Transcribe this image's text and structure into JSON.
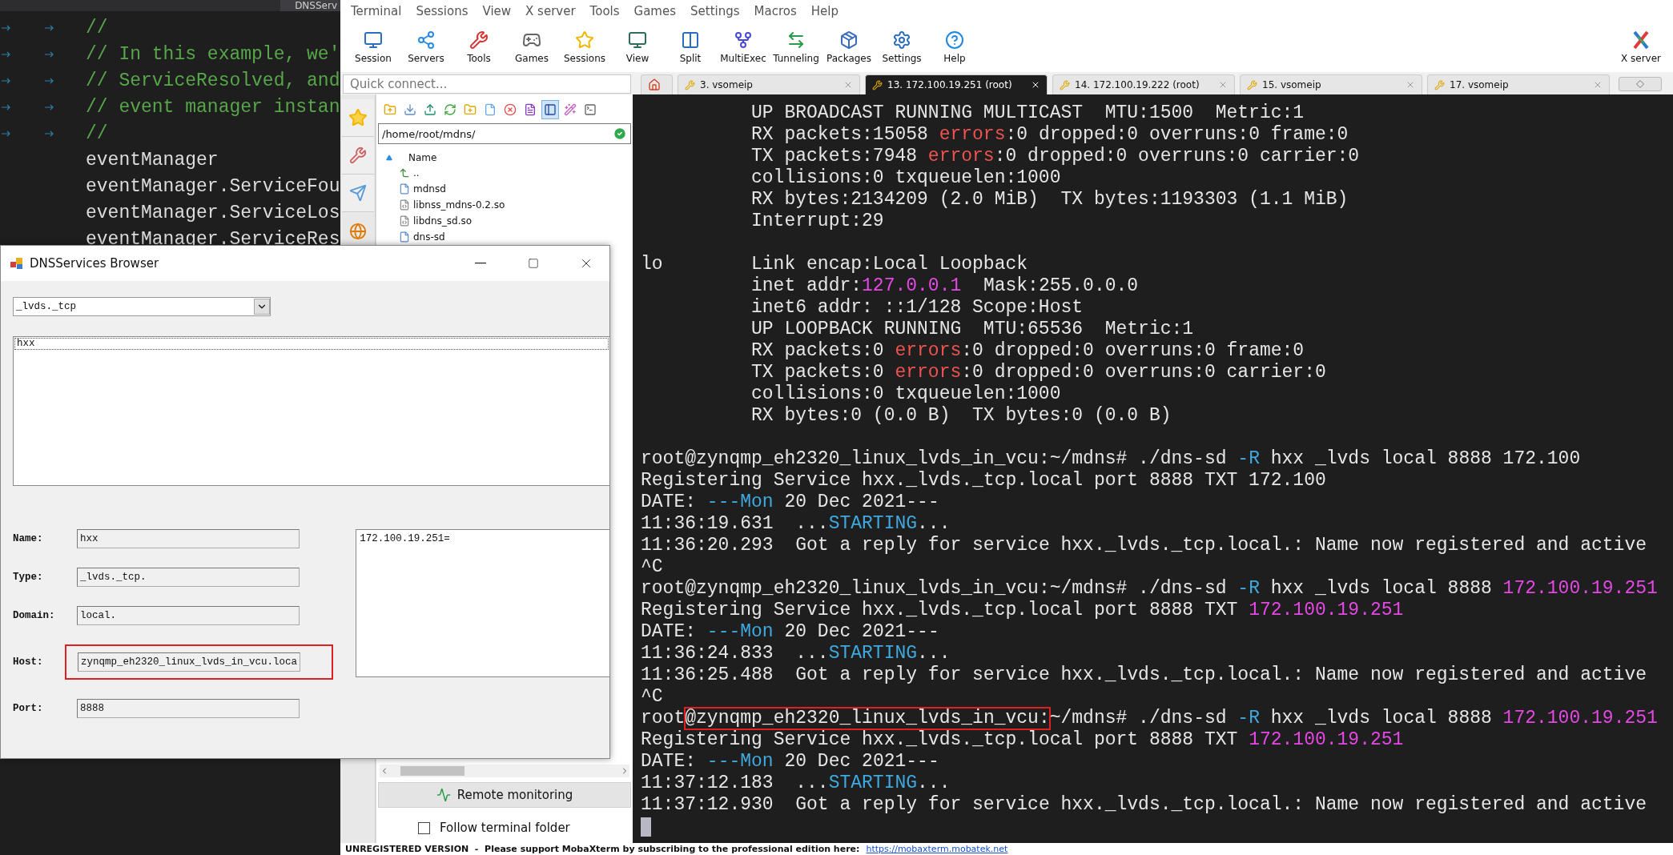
{
  "editor": {
    "tab": "DNSServ",
    "lines": [
      {
        "kind": "comment",
        "text": "//"
      },
      {
        "kind": "comment",
        "text": "// In this example, we'"
      },
      {
        "kind": "comment",
        "text": "// ServiceResolved, and"
      },
      {
        "kind": "comment",
        "text": "// event manager instan"
      },
      {
        "kind": "comment",
        "text": "//"
      },
      {
        "kind": "code",
        "text": "eventManager"
      },
      {
        "kind": "code",
        "text": "eventManager.ServiceFou"
      },
      {
        "kind": "code",
        "text": "eventManager.ServiceLos"
      },
      {
        "kind": "code",
        "text": "eventManager.ServiceRes"
      }
    ]
  },
  "menu": [
    "Terminal",
    "Sessions",
    "View",
    "X server",
    "Tools",
    "Games",
    "Settings",
    "Macros",
    "Help"
  ],
  "toolbar": [
    {
      "label": "Session"
    },
    {
      "label": "Servers"
    },
    {
      "label": "Tools"
    },
    {
      "label": "Games"
    },
    {
      "label": "Sessions"
    },
    {
      "label": "View"
    },
    {
      "label": "Split"
    },
    {
      "label": "MultiExec"
    },
    {
      "label": "Tunneling"
    },
    {
      "label": "Packages"
    },
    {
      "label": "Settings"
    },
    {
      "label": "Help"
    }
  ],
  "toolbar_right": {
    "label": "X server"
  },
  "quick_connect": {
    "placeholder": "Quick connect..."
  },
  "tabs": [
    {
      "kind": "home",
      "selected": false
    },
    {
      "kind": "session",
      "label": "3. vsomeip",
      "selected": false
    },
    {
      "kind": "session",
      "label": "13. 172.100.19.251 (root)",
      "selected": true
    },
    {
      "kind": "session",
      "label": "14. 172.100.19.222 (root)",
      "selected": false
    },
    {
      "kind": "session",
      "label": "15. vsomeip",
      "selected": false
    },
    {
      "kind": "session",
      "label": "17. vsomeip",
      "selected": false
    }
  ],
  "file_browser": {
    "path": "/home/root/mdns/",
    "column": "Name",
    "files": [
      {
        "name": "..",
        "kind": "parent"
      },
      {
        "name": "mdnsd",
        "kind": "file"
      },
      {
        "name": "libnss_mdns-0.2.so",
        "kind": "library"
      },
      {
        "name": "libdns_sd.so",
        "kind": "library"
      },
      {
        "name": "dns-sd",
        "kind": "file"
      }
    ]
  },
  "remote_monitoring": "Remote monitoring",
  "follow_terminal": {
    "label": "Follow terminal folder",
    "checked": false
  },
  "status_bar": {
    "text": "UNREGISTERED VERSION  -  Please support MobaXterm by subscribing to the professional edition here:",
    "link": "https://mobaxterm.mobatek.net"
  },
  "terminal": {
    "lines": [
      {
        "indent": true,
        "segments": [
          {
            "text": "UP BROADCAST RUNNING MULTICAST  MTU:1500  Metric:1",
            "color": "#e6e6e6"
          }
        ]
      },
      {
        "indent": true,
        "segments": [
          {
            "text": "RX packets:15058 ",
            "color": "#e6e6e6"
          },
          {
            "text": "errors",
            "color": "#ef5350"
          },
          {
            "text": ":0 dropped:0 overruns:0 frame:0",
            "color": "#e6e6e6"
          }
        ]
      },
      {
        "indent": true,
        "segments": [
          {
            "text": "TX packets:7948 ",
            "color": "#e6e6e6"
          },
          {
            "text": "errors",
            "color": "#ef5350"
          },
          {
            "text": ":0 dropped:0 overruns:0 carrier:0",
            "color": "#e6e6e6"
          }
        ]
      },
      {
        "indent": true,
        "segments": [
          {
            "text": "collisions:0 txqueuelen:1000",
            "color": "#e6e6e6"
          }
        ]
      },
      {
        "indent": true,
        "segments": [
          {
            "text": "RX bytes:2134209 (2.0 MiB)  TX bytes:1193303 (1.1 MiB)",
            "color": "#e6e6e6"
          }
        ]
      },
      {
        "indent": true,
        "segments": [
          {
            "text": "Interrupt:29",
            "color": "#e6e6e6"
          }
        ]
      },
      {
        "indent": true,
        "gap_before": true,
        "label": "lo",
        "segments": [
          {
            "text": "Link encap:Local Loopback",
            "color": "#e6e6e6"
          }
        ]
      },
      {
        "indent": true,
        "segments": [
          {
            "text": "inet addr:",
            "color": "#e6e6e6"
          },
          {
            "text": "127.0.0.1",
            "color": "#e548e5"
          },
          {
            "text": "  Mask:255.0.0.0",
            "color": "#e6e6e6"
          }
        ]
      },
      {
        "indent": true,
        "segments": [
          {
            "text": "inet6 addr: ::1/128 Scope:Host",
            "color": "#e6e6e6"
          }
        ]
      },
      {
        "indent": true,
        "segments": [
          {
            "text": "UP LOOPBACK RUNNING  MTU:65536  Metric:1",
            "color": "#e6e6e6"
          }
        ]
      },
      {
        "indent": true,
        "segments": [
          {
            "text": "RX packets:0 ",
            "color": "#e6e6e6"
          },
          {
            "text": "errors",
            "color": "#ef5350"
          },
          {
            "text": ":0 dropped:0 overruns:0 frame:0",
            "color": "#e6e6e6"
          }
        ]
      },
      {
        "indent": true,
        "segments": [
          {
            "text": "TX packets:0 ",
            "color": "#e6e6e6"
          },
          {
            "text": "errors",
            "color": "#ef5350"
          },
          {
            "text": ":0 dropped:0 overruns:0 carrier:0",
            "color": "#e6e6e6"
          }
        ]
      },
      {
        "indent": true,
        "segments": [
          {
            "text": "collisions:0 txqueuelen:1000",
            "color": "#e6e6e6"
          }
        ]
      },
      {
        "indent": true,
        "segments": [
          {
            "text": "RX bytes:0 (0.0 B)  TX bytes:0 (0.0 B)",
            "color": "#e6e6e6"
          }
        ]
      },
      {
        "gap_before": true,
        "segments": [
          {
            "text": "root@zynqmp_eh2320_linux_lvds_in_vcu:~/mdns# ./dns-sd ",
            "color": "#e6e6e6"
          },
          {
            "text": "-R",
            "color": "#3fa9e0"
          },
          {
            "text": " hxx _lvds local 8888 172.100",
            "color": "#e6e6e6"
          }
        ]
      },
      {
        "segments": [
          {
            "text": "Registering Service hxx._lvds._tcp.local port 8888 TXT 172.100",
            "color": "#e6e6e6"
          }
        ]
      },
      {
        "segments": [
          {
            "text": "DATE: ",
            "color": "#e6e6e6"
          },
          {
            "text": "---Mon",
            "color": "#3fa9e0"
          },
          {
            "text": " 20 Dec 2021---",
            "color": "#e6e6e6"
          }
        ]
      },
      {
        "segments": [
          {
            "text": "11:36:19.631  ...",
            "color": "#e6e6e6"
          },
          {
            "text": "STARTING",
            "color": "#3fa9e0"
          },
          {
            "text": "...",
            "color": "#e6e6e6"
          }
        ]
      },
      {
        "segments": [
          {
            "text": "11:36:20.293  Got a reply for service hxx._lvds._tcp.local.: Name now registered and active",
            "color": "#e6e6e6"
          }
        ]
      },
      {
        "segments": [
          {
            "text": "^C",
            "color": "#e6e6e6"
          }
        ]
      },
      {
        "segments": [
          {
            "text": "root@zynqmp_eh2320_linux_lvds_in_vcu:~/mdns# ./dns-sd ",
            "color": "#e6e6e6"
          },
          {
            "text": "-R",
            "color": "#3fa9e0"
          },
          {
            "text": " hxx _lvds local 8888 ",
            "color": "#e6e6e6"
          },
          {
            "text": "172.100.19.251",
            "color": "#e548e5"
          }
        ]
      },
      {
        "segments": [
          {
            "text": "Registering Service hxx._lvds._tcp.local port 8888 TXT ",
            "color": "#e6e6e6"
          },
          {
            "text": "172.100.19.251",
            "color": "#e548e5"
          }
        ]
      },
      {
        "segments": [
          {
            "text": "DATE: ",
            "color": "#e6e6e6"
          },
          {
            "text": "---Mon",
            "color": "#3fa9e0"
          },
          {
            "text": " 20 Dec 2021---",
            "color": "#e6e6e6"
          }
        ]
      },
      {
        "segments": [
          {
            "text": "11:36:24.833  ...",
            "color": "#e6e6e6"
          },
          {
            "text": "STARTING",
            "color": "#3fa9e0"
          },
          {
            "text": "...",
            "color": "#e6e6e6"
          }
        ]
      },
      {
        "segments": [
          {
            "text": "11:36:25.488  Got a reply for service hxx._lvds._tcp.local.: Name now registered and active",
            "color": "#e6e6e6"
          }
        ]
      },
      {
        "segments": [
          {
            "text": "^C",
            "color": "#e6e6e6"
          }
        ]
      },
      {
        "segments": [
          {
            "text": "root",
            "color": "#e6e6e6"
          },
          {
            "text": "@zynqmp_eh2320_linux_lvds_in_vcu:",
            "color": "#e6e6e6",
            "highlight": true
          },
          {
            "text": "~/mdns# ./dns-sd ",
            "color": "#e6e6e6"
          },
          {
            "text": "-R",
            "color": "#3fa9e0"
          },
          {
            "text": " hxx _lvds local 8888 ",
            "color": "#e6e6e6"
          },
          {
            "text": "172.100.19.251",
            "color": "#e548e5"
          }
        ]
      },
      {
        "segments": [
          {
            "text": "Registering Service hxx._lvds._tcp.local port 8888 TXT ",
            "color": "#e6e6e6"
          },
          {
            "text": "172.100.19.251",
            "color": "#e548e5"
          }
        ]
      },
      {
        "segments": [
          {
            "text": "DATE: ",
            "color": "#e6e6e6"
          },
          {
            "text": "---Mon",
            "color": "#3fa9e0"
          },
          {
            "text": " 20 Dec 2021---",
            "color": "#e6e6e6"
          }
        ]
      },
      {
        "segments": [
          {
            "text": "11:37:12.183  ...",
            "color": "#e6e6e6"
          },
          {
            "text": "STARTING",
            "color": "#3fa9e0"
          },
          {
            "text": "...",
            "color": "#e6e6e6"
          }
        ]
      },
      {
        "segments": [
          {
            "text": "11:37:12.930  Got a reply for service hxx._lvds._tcp.local.: Name now registered and active",
            "color": "#e6e6e6"
          }
        ]
      }
    ]
  },
  "dialog": {
    "title": "DNSServices Browser",
    "service_type": "_lvds._tcp",
    "services": [
      {
        "name": "hxx",
        "selected": true
      }
    ],
    "fields": [
      {
        "label": "Name:",
        "value": "hxx",
        "highlight": false
      },
      {
        "label": "Type:",
        "value": "_lvds._tcp.",
        "highlight": false
      },
      {
        "label": "Domain:",
        "value": "local.",
        "highlight": false
      },
      {
        "label": "Host:",
        "value": "zynqmp_eh2320_linux_lvds_in_vcu.loca",
        "highlight": true
      },
      {
        "label": "Port:",
        "value": "8888",
        "highlight": false
      }
    ],
    "txt_record": "172.100.19.251="
  }
}
